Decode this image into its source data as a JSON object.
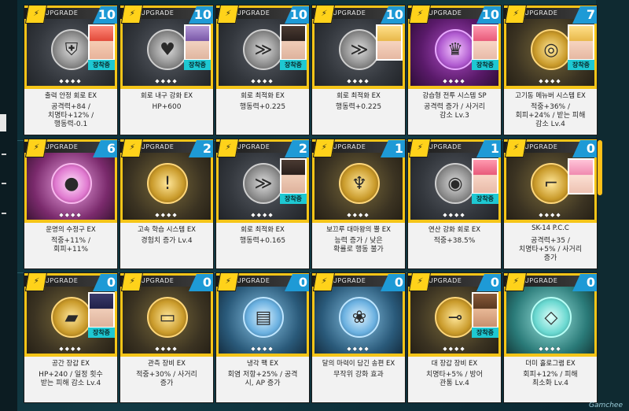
{
  "screen": {
    "upgrade_label": "UPGRADE",
    "equipped_label": "장착중",
    "watermark": "Gamchee",
    "colors": {
      "accent_gold": "#f5c518",
      "count_blue": "#1e9ad6",
      "equip_teal": "#1ec8d2"
    }
  },
  "cards": [
    {
      "count": "10",
      "name": "출력 안정 회로 EX",
      "desc": "공격력+84 /\n치명타+12% /\n행동력-0.1",
      "equipped": true,
      "theme": "gray",
      "portrait": "red",
      "icon": "shield-chevron-icon"
    },
    {
      "count": "10",
      "name": "회로 내구 강화 EX",
      "desc": "HP+600",
      "equipped": true,
      "theme": "gray",
      "portrait": "violet",
      "icon": "heart-chevron-icon"
    },
    {
      "count": "10",
      "name": "회로 최적화 EX",
      "desc": "행동력+0.225",
      "equipped": true,
      "theme": "gray",
      "portrait": "dark",
      "icon": "speed-lines-icon"
    },
    {
      "count": "10",
      "name": "회로 최적화 EX",
      "desc": "행동력+0.225",
      "equipped": false,
      "theme": "gray",
      "portrait": "blond",
      "icon": "speed-lines-icon"
    },
    {
      "count": "10",
      "name": "강습형 전투 시스템 SP",
      "desc": "공격력 증가 / 사거리\n감소 Lv.3",
      "equipped": true,
      "theme": "purple",
      "portrait": "pinkh",
      "icon": "crown-emblem-icon"
    },
    {
      "count": "7",
      "name": "고기동 메뉴버 시스템 EX",
      "desc": "적중+36% /\n회피+24% / 받는 피해\n감소 Lv.4",
      "equipped": true,
      "theme": "gold",
      "portrait": "blond",
      "icon": "target-ring-icon"
    },
    {
      "count": "6",
      "name": "운명의 수정구 EX",
      "desc": "적중+11% /\n회피+11%",
      "equipped": false,
      "theme": "pink",
      "portrait": "",
      "icon": "crystal-ball-icon"
    },
    {
      "count": "2",
      "name": "고속 학습 시스템 EX",
      "desc": "경험치 증가 Lv.4",
      "equipped": false,
      "theme": "gold",
      "portrait": "",
      "icon": "exclamation-badge-icon"
    },
    {
      "count": "2",
      "name": "회로 최적화 EX",
      "desc": "행동력+0.165",
      "equipped": true,
      "theme": "gray",
      "portrait": "dark",
      "icon": "speed-lines-icon"
    },
    {
      "count": "1",
      "name": "보끄루 대마왕의 뿔 EX",
      "desc": "능력 증가 / 낮은\n확률로 행동 불가",
      "equipped": false,
      "theme": "gold",
      "portrait": "",
      "icon": "demon-horn-icon"
    },
    {
      "count": "1",
      "name": "연산 강화 회로 EX",
      "desc": "적중+38.5%",
      "equipped": true,
      "theme": "gray",
      "portrait": "pinkh",
      "icon": "target-circle-icon"
    },
    {
      "count": "0",
      "name": "SK-14 P.C.C",
      "desc": "공격력+35 /\n치명타+5% / 사거리\n증가",
      "equipped": false,
      "theme": "gold",
      "portrait": "pink2",
      "icon": "rifle-icon"
    },
    {
      "count": "0",
      "name": "공간 장갑 EX",
      "desc": "HP+240 / 일정 횟수\n받는 피해 감소 Lv.4",
      "equipped": true,
      "theme": "gold",
      "portrait": "navy",
      "icon": "armor-plate-icon"
    },
    {
      "count": "0",
      "name": "관측 장비 EX",
      "desc": "적중+30% / 사거리\n증가",
      "equipped": false,
      "theme": "gold",
      "portrait": "",
      "icon": "monitor-tripod-icon"
    },
    {
      "count": "0",
      "name": "냉각 팩 EX",
      "desc": "회염 저항+25% / 공격\n시, AP 증가",
      "equipped": false,
      "theme": "blue",
      "portrait": "",
      "icon": "cooling-pack-icon"
    },
    {
      "count": "0",
      "name": "달의 마력이 담긴 송편 EX",
      "desc": "무작위 강화 효과",
      "equipped": false,
      "theme": "blue",
      "portrait": "",
      "icon": "songpyeon-plate-icon"
    },
    {
      "count": "0",
      "name": "대 장갑 장비 EX",
      "desc": "치명타+5% / 방어\n관통 Lv.4",
      "equipped": true,
      "theme": "gold",
      "portrait": "brown",
      "icon": "cannon-icon"
    },
    {
      "count": "0",
      "name": "더미 홀로그램 EX",
      "desc": "회피+12% / 피해\n최소화 Lv.4",
      "equipped": false,
      "theme": "teal",
      "portrait": "",
      "icon": "hologram-icon"
    }
  ]
}
